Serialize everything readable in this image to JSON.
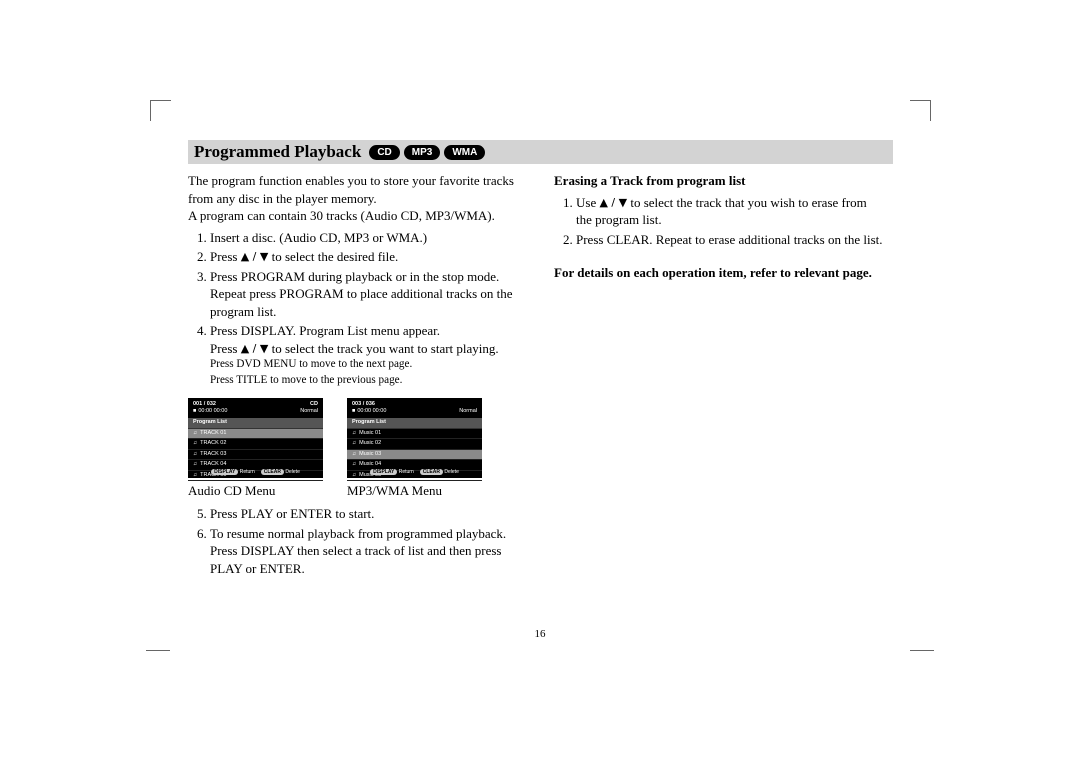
{
  "heading": {
    "title": "Programmed Playback",
    "badges": [
      "CD",
      "MP3",
      "WMA"
    ]
  },
  "left": {
    "intro1": "The program function enables you to store your favorite tracks from any disc in the player memory.",
    "intro2": "A program can contain 30 tracks (Audio CD, MP3/WMA).",
    "step1": "Insert a disc. (Audio CD, MP3 or WMA.)",
    "step2a": "Press ",
    "step2_arrows": "▲ / ▼",
    "step2b": " to select the desired file.",
    "step3": "Press PROGRAM during playback or in the stop mode. Repeat press PROGRAM to place additional tracks on the program list.",
    "step4a": "Press DISPLAY. Program List menu appear.",
    "step4b_pre": "Press ",
    "step4b_arrows": "▲ / ▼",
    "step4b_post": " to select the track you want to start playing.",
    "step4c": "Press DVD MENU to move to the next page.",
    "step4d": "Press TITLE to move to the previous page.",
    "menu1_caption": "Audio CD Menu",
    "menu2_caption": "MP3/WMA Menu",
    "step5": "Press PLAY or ENTER to start.",
    "step6": "To resume normal playback from programmed playback. Press DISPLAY then select a track of list and then press PLAY or ENTER."
  },
  "osd1": {
    "counter": "001 / 032",
    "type": "CD",
    "time": "00:00  00:00",
    "mode": "Normal",
    "header": "Program List",
    "rows": [
      "TRACK 01",
      "TRACK 02",
      "TRACK 03",
      "TRACK 04",
      "TRACK 05"
    ],
    "btn1": "DISPLAY",
    "btn1_label": "Return",
    "btn2": "CLEAR",
    "btn2_label": "Delete"
  },
  "osd2": {
    "counter": "003 / 036",
    "type": "",
    "time": "00:00  00:00",
    "mode": "Normal",
    "header": "Program List",
    "rows": [
      "Music 01",
      "Music 02",
      "Music 03",
      "Music 04",
      "Music 05"
    ],
    "btn1": "DISPLAY",
    "btn1_label": "Return",
    "btn2": "CLEAR",
    "btn2_label": "Delete"
  },
  "right": {
    "sub_heading": "Erasing a Track from program list",
    "r1a": "Use  ",
    "r1_arrows": "▲ / ▼",
    "r1b": " to select the track that you wish to erase from the program list.",
    "r2": "Press CLEAR. Repeat to erase additional tracks on the list.",
    "footnote": "For details on each operation item, refer to relevant page."
  },
  "page_number": "16"
}
